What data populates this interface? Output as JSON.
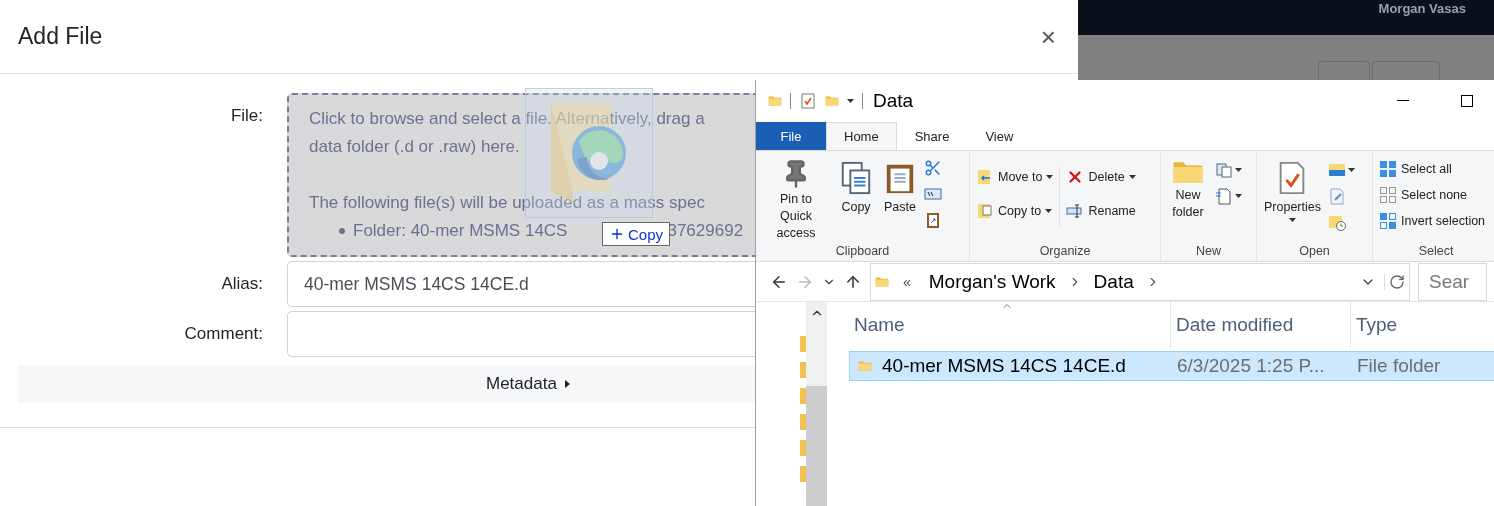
{
  "navbar": {
    "user": "Morgan Vasas"
  },
  "dialog": {
    "title": "Add File",
    "close": "×",
    "file_label": "File:",
    "dropzone": {
      "lines": [
        "Click to browse and select a file. Alternatively, drag a",
        "data folder (.d or .raw) here."
      ],
      "notice": "The following file(s) will be uploaded as a mass spec",
      "items": [
        {
          "text": "Folder: 40-mer MSMS 14CS",
          "tail": "37629692"
        }
      ]
    },
    "drag": {
      "badge": "Copy"
    },
    "fields": [
      {
        "label": "Alias:",
        "value": "40-mer MSMS 14CS 14CE.d"
      },
      {
        "label": "Comment:"
      }
    ],
    "metadata": {
      "label": "Metadata",
      "expanded": false
    }
  },
  "explorer": {
    "title": "Data",
    "tabs": [
      {
        "label": "File",
        "kind": "file",
        "selected": false
      },
      {
        "label": "Home",
        "kind": "tab",
        "selected": true
      },
      {
        "label": "Share",
        "kind": "tab",
        "selected": false
      },
      {
        "label": "View",
        "kind": "tab",
        "selected": false
      }
    ],
    "groups": [
      {
        "label": "Clipboard",
        "buttons": [
          {
            "label": "Pin to Quick access",
            "kind": "large"
          },
          {
            "label": "Copy",
            "kind": "large"
          },
          {
            "label": "Paste",
            "kind": "large"
          }
        ]
      },
      {
        "label": "Organize",
        "buttons": [
          {
            "label": "Move to",
            "kind": "small"
          },
          {
            "label": "Copy to",
            "kind": "small"
          },
          {
            "label": "Delete",
            "kind": "small"
          },
          {
            "label": "Rename",
            "kind": "small"
          }
        ]
      },
      {
        "label": "New",
        "buttons": [
          {
            "label": "New folder",
            "kind": "large"
          }
        ]
      },
      {
        "label": "Open",
        "buttons": [
          {
            "label": "Properties",
            "kind": "large"
          }
        ]
      },
      {
        "label": "Select",
        "buttons": [
          {
            "label": "Select all",
            "kind": "small"
          },
          {
            "label": "Select none",
            "kind": "small"
          },
          {
            "label": "Invert selection",
            "kind": "small"
          }
        ]
      }
    ],
    "address": {
      "prefix": "«",
      "crumbs": [
        "Morgan's Work",
        "Data"
      ]
    },
    "search": {
      "placeholder": "Sear"
    },
    "columns": [
      "Name",
      "Date modified",
      "Type"
    ],
    "rows": [
      {
        "name": "40-mer MSMS 14CS 14CE.d",
        "date": "6/3/2025 1:25 P...",
        "type": "File folder",
        "selected": true
      }
    ]
  }
}
